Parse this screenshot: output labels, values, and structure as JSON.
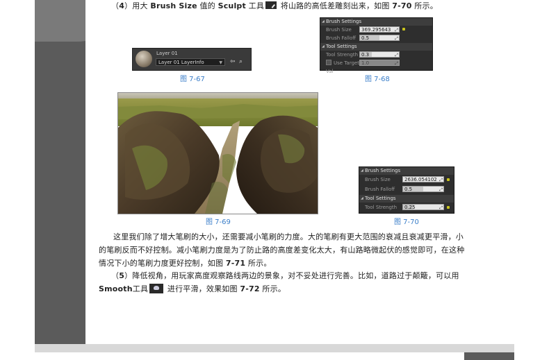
{
  "paragraph4": {
    "prefix": "（",
    "num": "4",
    "close": "）",
    "t1": "用大 ",
    "brush_size": "Brush Size",
    "t2": " 值的 ",
    "sculpt": "Sculpt",
    "t3": " 工具",
    "t4": " 将山路的高低差雕刻出来，如图 ",
    "fig_ref": "7-70",
    "t5": " 所示。"
  },
  "fig67": {
    "layer_name": "Layer 01",
    "layer_info": "Layer 01 LayerInfo",
    "caption": "图 7-67"
  },
  "fig68": {
    "brush_header": "Brush Settings",
    "brush_size_label": "Brush Size",
    "brush_size_value": "369.295643",
    "brush_falloff_label": "Brush Falloff",
    "brush_falloff_value": "0.5",
    "brush_falloff_fraction": 0.5,
    "tool_header": "Tool Settings",
    "tool_strength_label": "Tool Strength",
    "tool_strength_value": "0.3",
    "tool_strength_fraction": 0.3,
    "target_label": "Use Target Val",
    "target_value": "1.0",
    "caption": "图 7-68"
  },
  "fig69": {
    "caption": "图 7-69"
  },
  "fig70": {
    "brush_header": "Brush Settings",
    "brush_size_label": "Brush Size",
    "brush_size_value": "2636.054102",
    "brush_falloff_label": "Brush Falloff",
    "brush_falloff_value": "0.5",
    "brush_falloff_fraction": 0.5,
    "tool_header": "Tool Settings",
    "tool_strength_label": "Tool Strength",
    "tool_strength_value": "0.25",
    "tool_strength_fraction": 0.25,
    "caption": "图 7-70"
  },
  "body": {
    "line1": "这里我们除了增大笔刷的大小，还需要减小笔刷的力度。大的笔刷有更大范围的衰减且衰减更平滑，小",
    "line2": "的笔刷反而不好控制。减小笔刷力度是为了防止路的高度差变化太大，有山路略微起伏的感觉即可，在这种",
    "line3_a": "情况下小的笔刷力度更好控制，如图 ",
    "line3_ref": "7-71",
    "line3_b": " 所示。"
  },
  "paragraph5": {
    "prefix": "（",
    "num": "5",
    "close": "）",
    "line1": "降低视角，用玩家高度观察路线两边的景象，对不妥处进行完善。比如，道路过于颠簸，可以用",
    "smooth": "Smooth",
    "t1": "工具",
    "t2": " 进行平滑，效果如图 ",
    "fig_ref": "7-72",
    "t3": " 所示。"
  }
}
